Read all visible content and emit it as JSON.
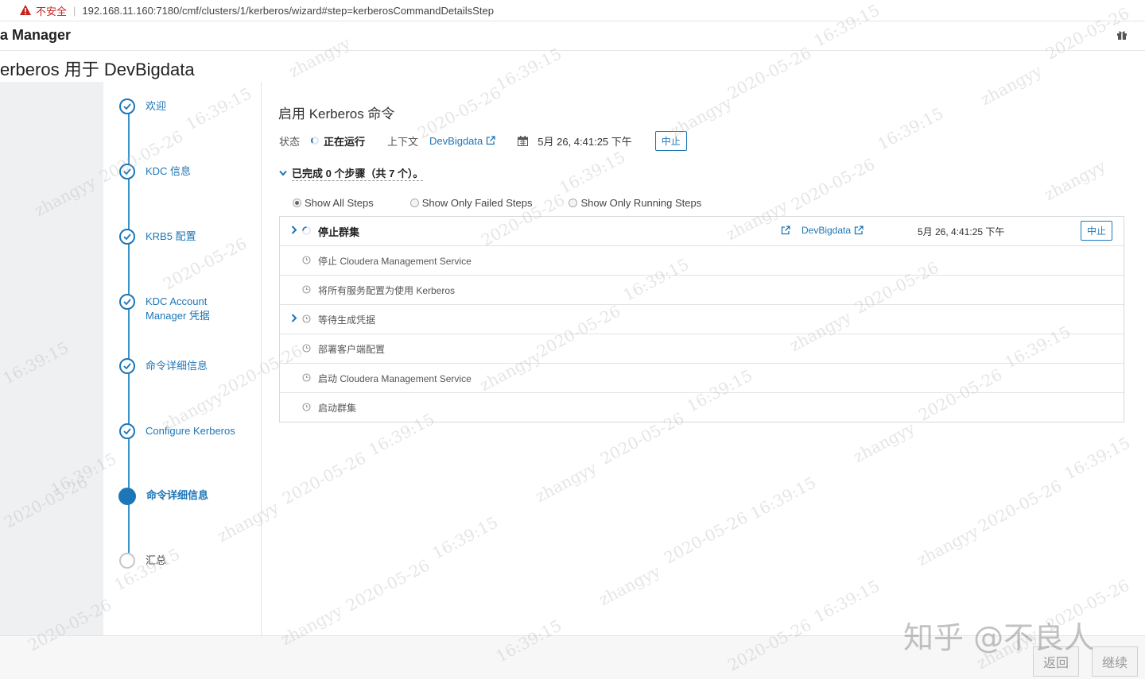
{
  "browser": {
    "security_label": "不安全",
    "separator": "|",
    "url": "192.168.11.160:7180/cmf/clusters/1/kerberos/wizard#step=kerberosCommandDetailsStep"
  },
  "app": {
    "title": "a Manager"
  },
  "page": {
    "title": "erberos 用于 DevBigdata"
  },
  "wizard": {
    "steps": [
      {
        "label": "欢迎",
        "state": "done"
      },
      {
        "label": "KDC 信息",
        "state": "done"
      },
      {
        "label": "KRB5 配置",
        "state": "done"
      },
      {
        "label": "KDC Account Manager 凭据",
        "state": "done"
      },
      {
        "label": "命令详细信息",
        "state": "done"
      },
      {
        "label": "Configure Kerberos",
        "state": "done"
      },
      {
        "label": "命令详细信息",
        "state": "active"
      },
      {
        "label": "汇总",
        "state": "todo"
      }
    ]
  },
  "command": {
    "title": "启用 Kerberos 命令",
    "status_label": "状态",
    "status_value": "正在运行",
    "context_label": "上下文",
    "context_value": "DevBigdata",
    "date": "5月 26, 4:41:25 下午",
    "abort_label": "中止",
    "summary": "已完成 0 个步骤（共 7 个）。",
    "filters": [
      {
        "label": "Show All Steps",
        "selected": true
      },
      {
        "label": "Show Only Failed Steps",
        "selected": false
      },
      {
        "label": "Show Only Running Steps",
        "selected": false
      }
    ],
    "steps": [
      {
        "name": "停止群集",
        "context": "DevBigdata",
        "date": "5月 26, 4:41:25 下午",
        "action": "中止"
      },
      {
        "name": "停止 Cloudera Management Service"
      },
      {
        "name": "将所有服务配置为使用 Kerberos"
      },
      {
        "name": "等待生成凭据"
      },
      {
        "name": "部署客户端配置"
      },
      {
        "name": "启动 Cloudera Management Service"
      },
      {
        "name": "启动群集"
      }
    ]
  },
  "footer": {
    "back_label": "返回",
    "continue_label": "继续"
  },
  "watermark": {
    "user": "zhangyy",
    "date": "2020-05-26",
    "time": "16:39:15",
    "brand": "知乎 @不良人"
  },
  "colors": {
    "link": "#1d76b8",
    "warning": "#c5221f",
    "gutter": "#eef0f2"
  }
}
